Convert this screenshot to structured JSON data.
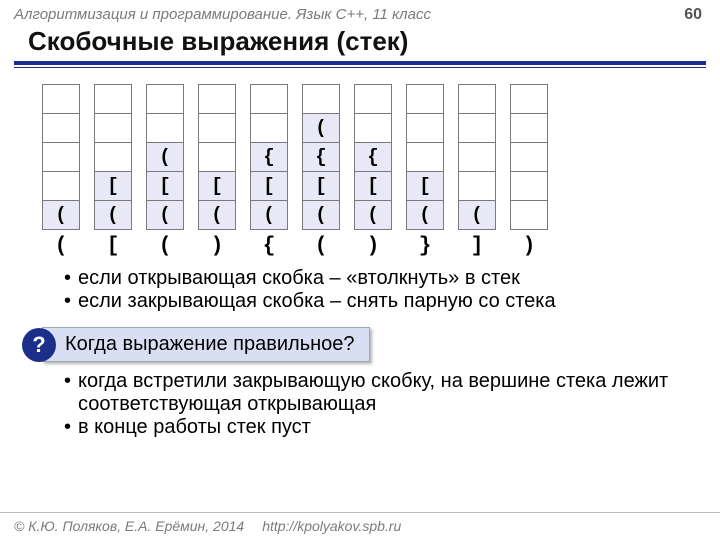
{
  "header": {
    "course": "Алгоритмизация и программирование. Язык C++, 11 класс",
    "page": "60"
  },
  "title": "Скобочные выражения (стек)",
  "stacks": [
    {
      "cells": [
        "",
        "",
        "",
        "",
        "("
      ],
      "input": "("
    },
    {
      "cells": [
        "",
        "",
        "",
        "[",
        "("
      ],
      "input": "["
    },
    {
      "cells": [
        "",
        "",
        "(",
        "[",
        "("
      ],
      "input": "("
    },
    {
      "cells": [
        "",
        "",
        "",
        "[",
        "("
      ],
      "input": ")"
    },
    {
      "cells": [
        "",
        "",
        "{",
        "[",
        "("
      ],
      "input": "{"
    },
    {
      "cells": [
        "",
        "(",
        "{",
        "[",
        "("
      ],
      "input": "("
    },
    {
      "cells": [
        "",
        "",
        "{",
        "[",
        "("
      ],
      "input": ")"
    },
    {
      "cells": [
        "",
        "",
        "",
        "[",
        "("
      ],
      "input": "}"
    },
    {
      "cells": [
        "",
        "",
        "",
        "",
        "("
      ],
      "input": "]"
    },
    {
      "cells": [
        "",
        "",
        "",
        "",
        ""
      ],
      "input": ")"
    }
  ],
  "rules": [
    "если открывающая скобка – «втолкнуть» в стек",
    "если закрывающая скобка – снять парную со стека"
  ],
  "question": {
    "mark": "?",
    "text": "Когда выражение правильное?"
  },
  "answers": [
    "когда встретили закрывающую скобку, на вершине стека лежит соответствующая открывающая",
    "в конце работы стек пуст"
  ],
  "footer": {
    "copyright": "© К.Ю. Поляков, Е.А. Ерёмин, 2014",
    "url": "http://kpolyakov.spb.ru"
  }
}
